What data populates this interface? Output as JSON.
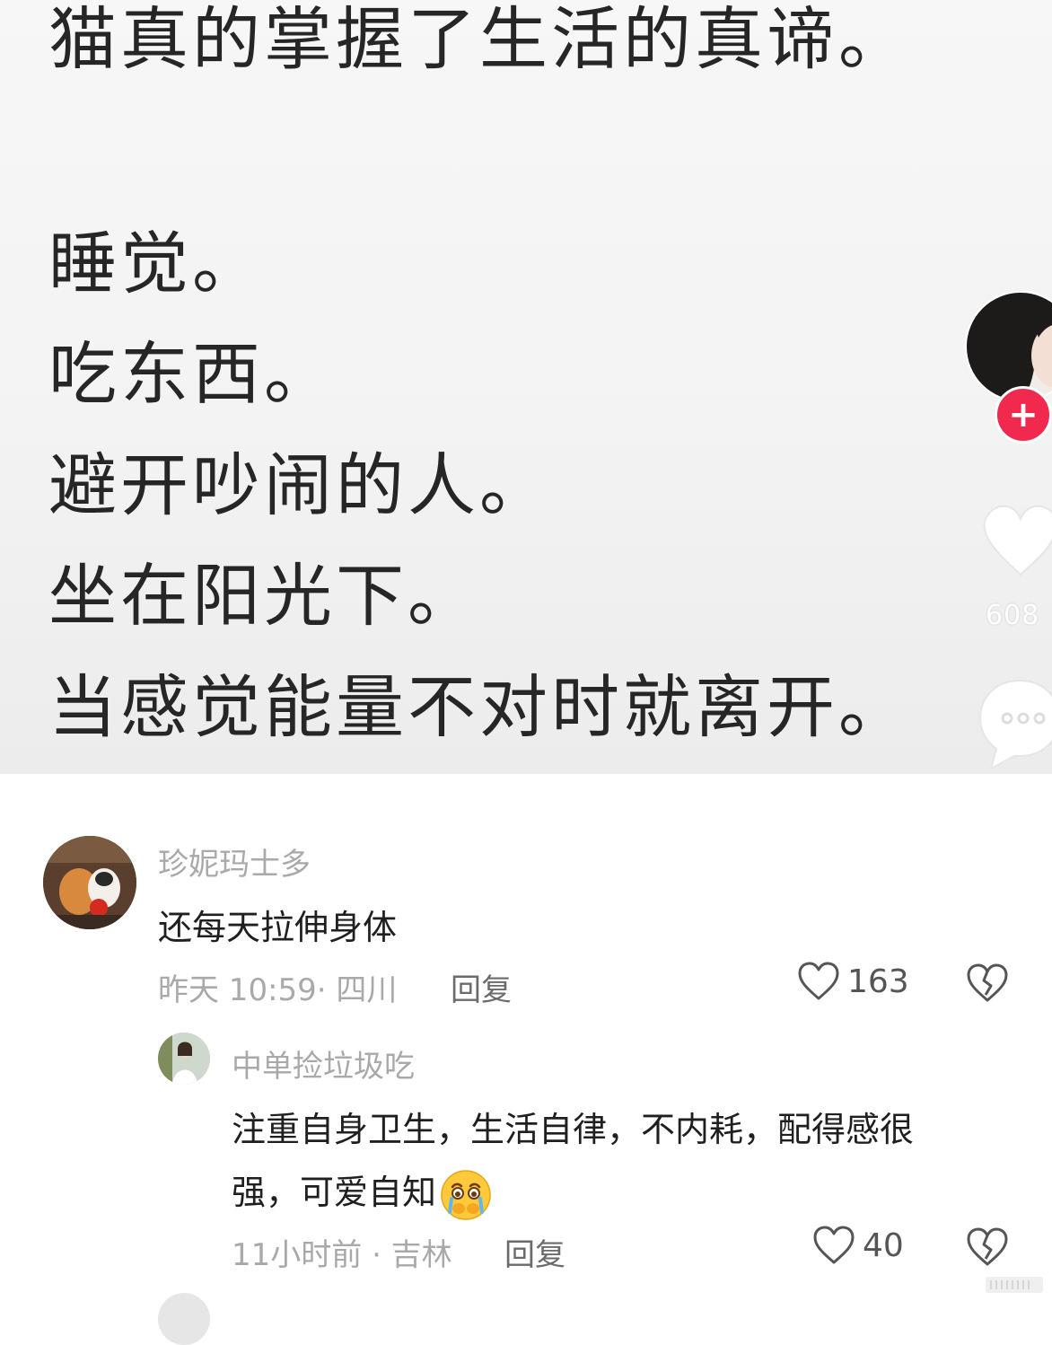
{
  "post": {
    "lines": [
      "猫真的掌握了生活的真谛。",
      "睡觉。",
      "吃东西。",
      "避开吵闹的人。",
      "坐在阳光下。",
      "当感觉能量不对时就离开。"
    ],
    "follow_symbol": "+",
    "rail_like_count": "608",
    "icons": [
      "heart-icon",
      "comment-bubble-icon"
    ]
  },
  "comments": [
    {
      "username": "珍妮玛士多",
      "text": "还每天拉伸身体",
      "time_location": "昨天 10:59· 四川",
      "reply_label": "回复",
      "like_count": "163",
      "replies": [
        {
          "username": "中单捡垃圾吃",
          "text_line1": "注重自身卫生，生活自律，不内耗，配得感很",
          "text_line2": "强，可爱自知",
          "emoji": "crying-face-emoji",
          "time_location": "11小时前 · 吉林",
          "reply_label": "回复",
          "like_count": "40"
        }
      ]
    }
  ],
  "colors": {
    "follow_button": "#f2294f",
    "text_primary": "#1f1f1f",
    "text_secondary": "#a9a9a9"
  }
}
